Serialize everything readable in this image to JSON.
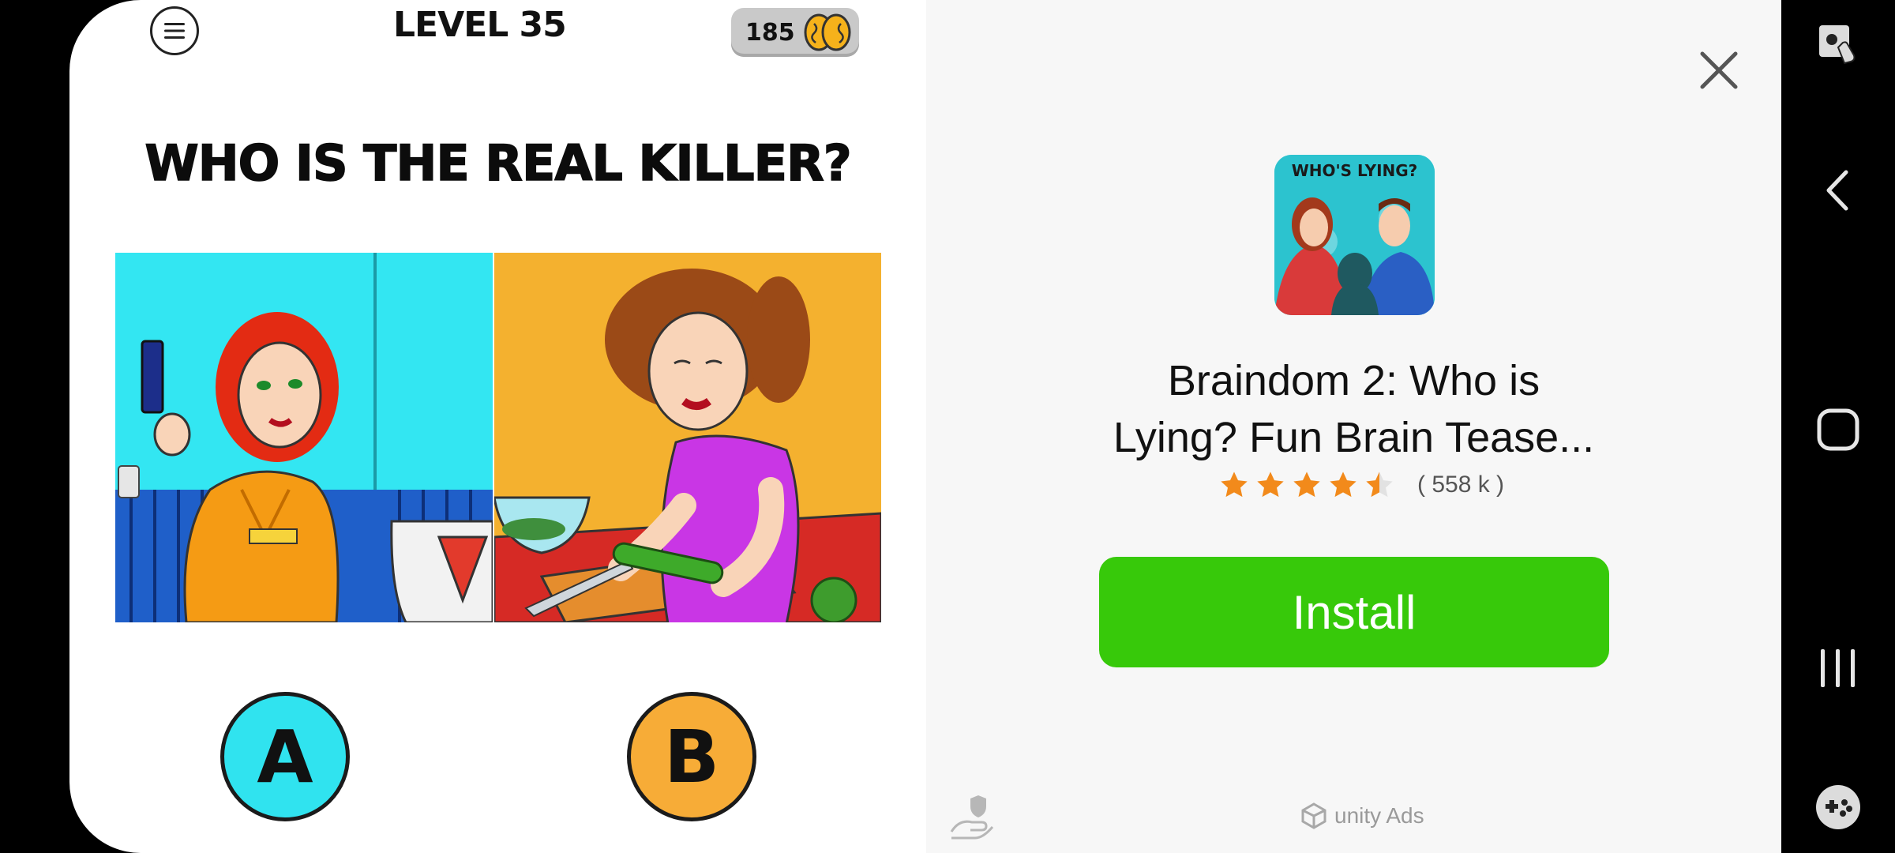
{
  "game": {
    "level_label": "LEVEL 35",
    "coins": "185",
    "question": "WHO IS THE REAL KILLER?",
    "answer_a": "A",
    "answer_b": "B"
  },
  "ad": {
    "app_icon_title": "WHO'S LYING?",
    "app_name_line1": "Braindom 2: Who is",
    "app_name_line2": "Lying? Fun Brain Tease...",
    "rating_value": 4.5,
    "rating_count": "( 558 k )",
    "install_label": "Install",
    "network_label": "unity Ads"
  },
  "colors": {
    "install_green": "#37c90a",
    "answer_a_cyan": "#30e3ef",
    "answer_b_orange": "#f7ac37",
    "star_orange": "#f28a1b"
  },
  "icons": {
    "menu": "hamburger-menu-icon",
    "brain": "brain-icon",
    "close": "close-icon",
    "privacy": "privacy-hand-shield-icon",
    "unity": "unity-logo-icon",
    "nav_back": "back-chevron-icon",
    "nav_home": "home-square-icon",
    "nav_recents": "recents-bars-icon",
    "nav_game": "game-controller-icon",
    "nav_touch": "touch-lock-icon"
  }
}
